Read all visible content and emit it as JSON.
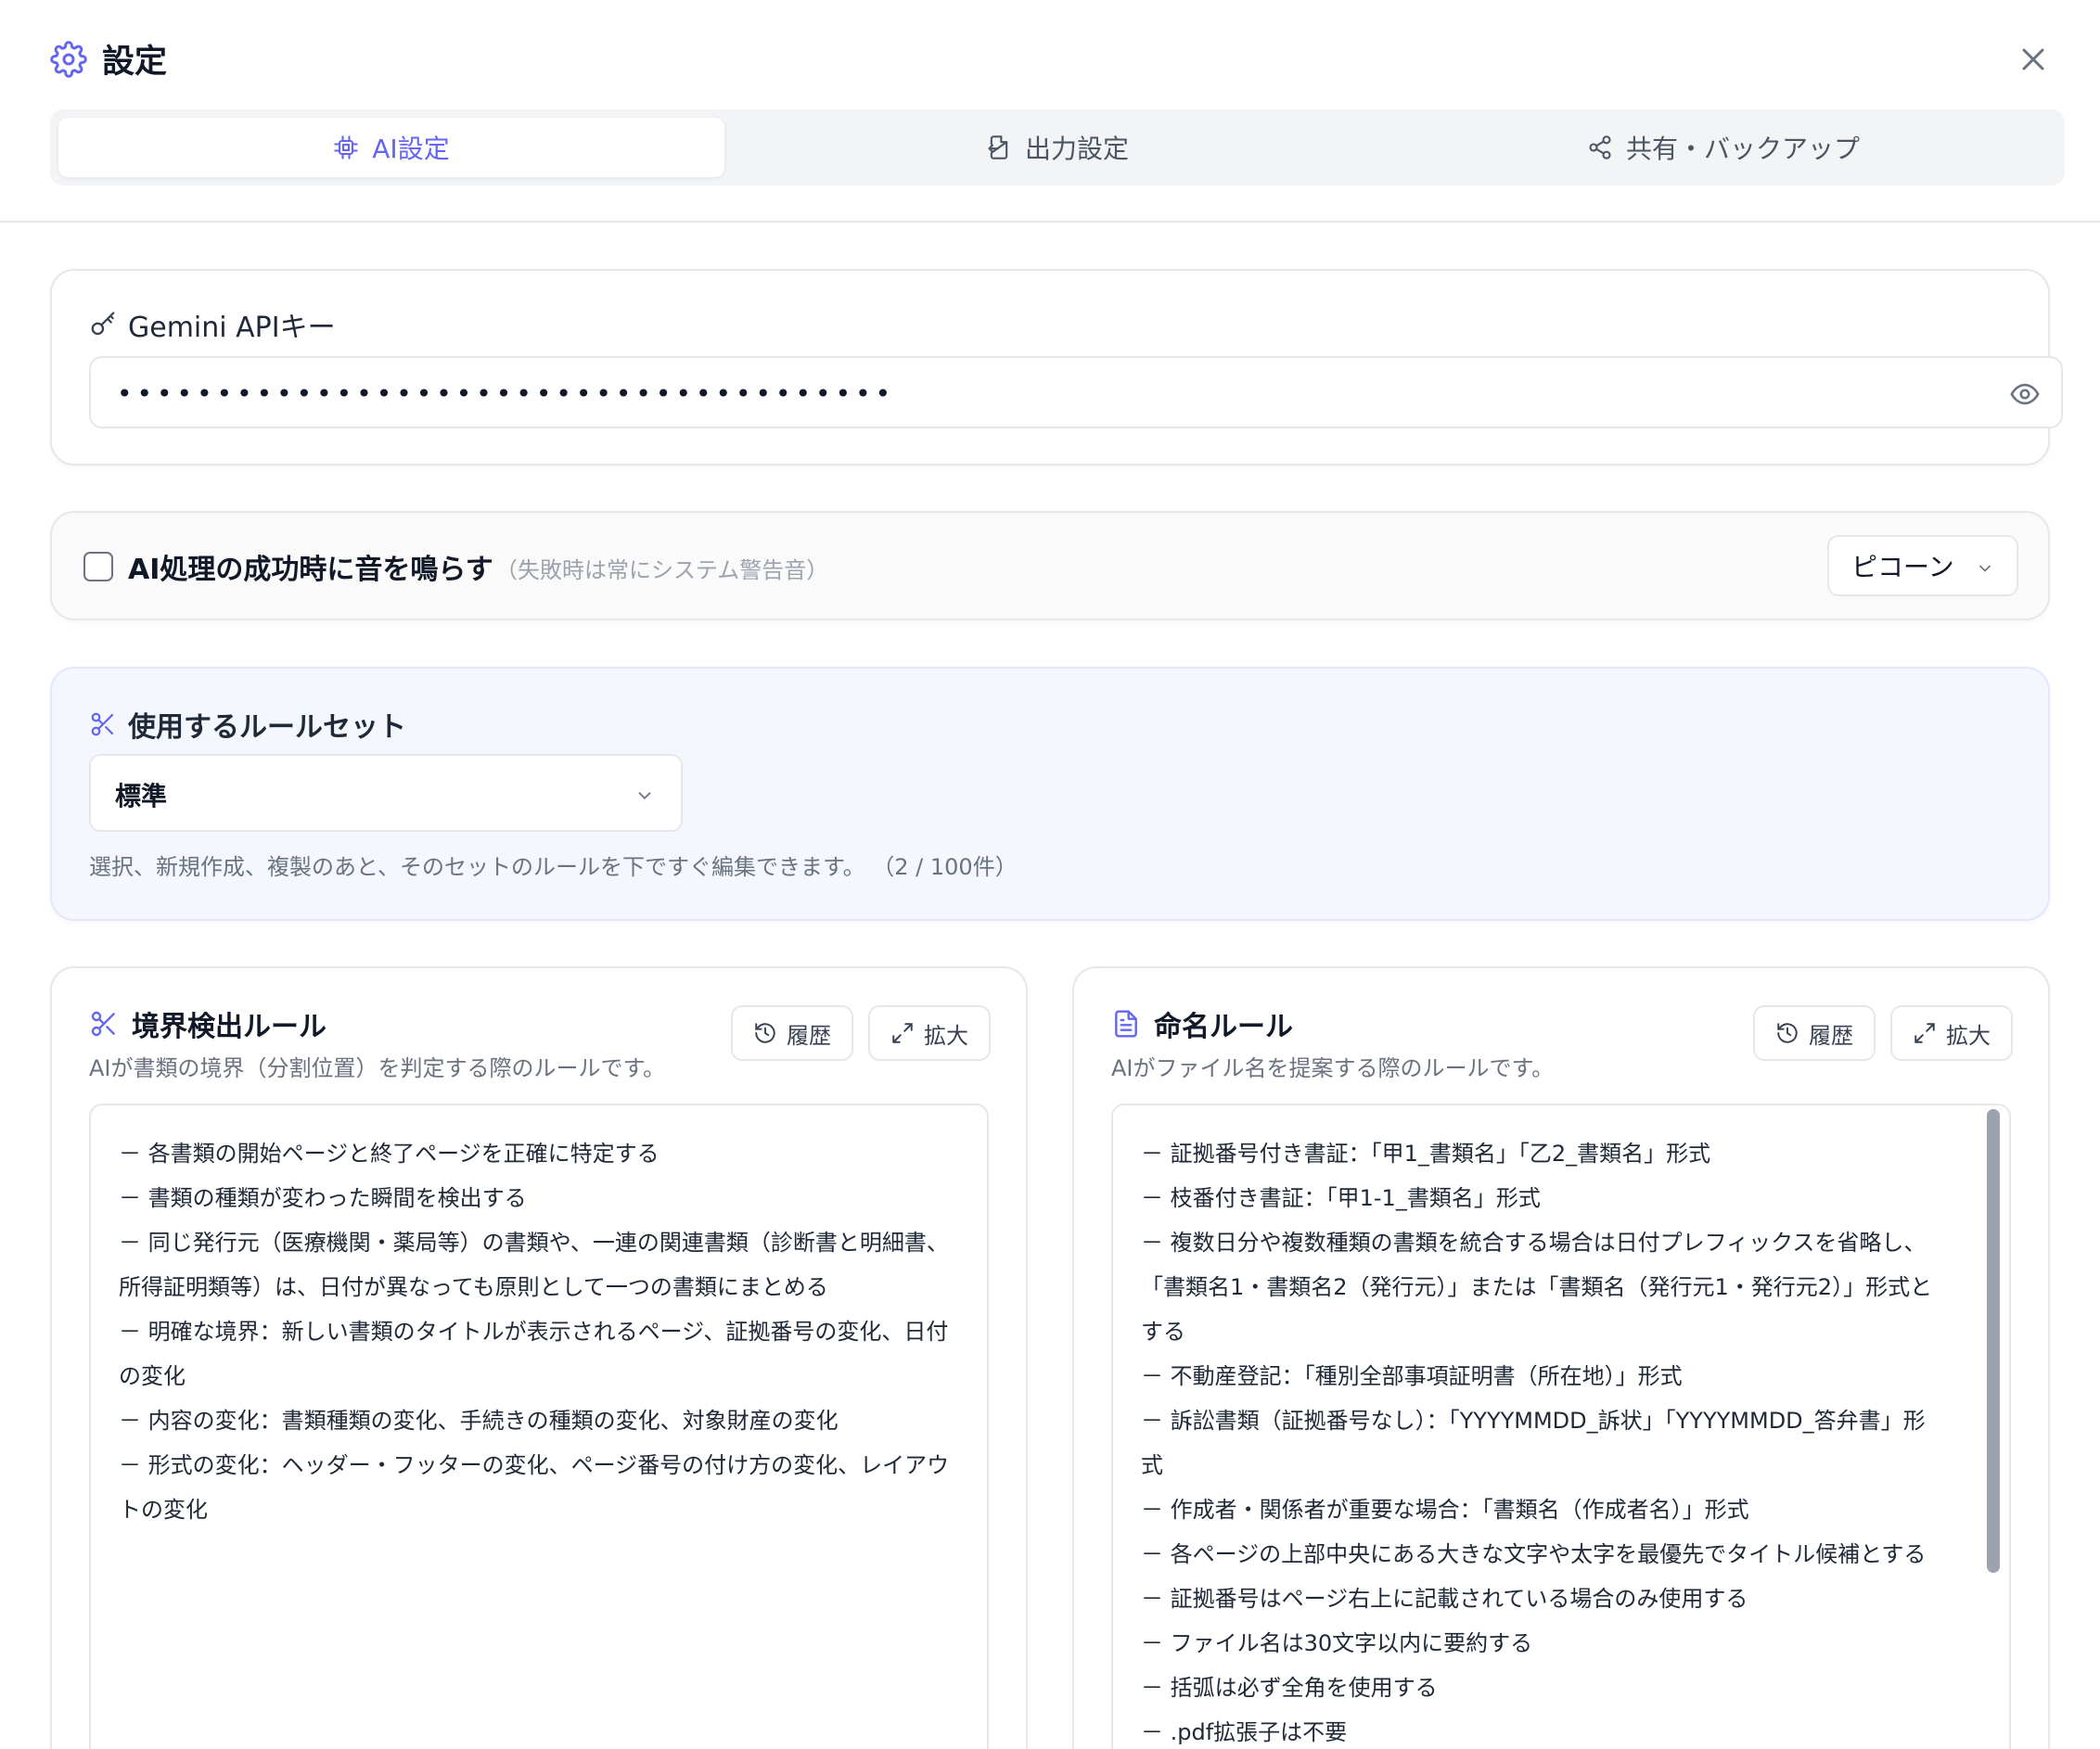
{
  "header": {
    "title": "設定",
    "close_label": "×"
  },
  "tabs": [
    {
      "label": "AI設定",
      "active": true,
      "icon": "chip-icon"
    },
    {
      "label": "出力設定",
      "active": false,
      "icon": "file-export-icon"
    },
    {
      "label": "共有・バックアップ",
      "active": false,
      "icon": "share-icon"
    }
  ],
  "api_key": {
    "label": "Gemini APIキー",
    "masked_value": "•••••••••••••••••••••••••••••••••••••••"
  },
  "sound": {
    "label": "AI処理の成功時に音を鳴らす",
    "note": "（失敗時は常にシステム警告音）",
    "checked": false,
    "selected_sound": "ピコーン"
  },
  "ruleset": {
    "label": "使用するルールセット",
    "selected": "標準",
    "help": "選択、新規作成、複製のあと、そのセットのルールを下ですぐ編集できます。 （2 / 100件）"
  },
  "boundary_rules": {
    "title": "境界検出ルール",
    "subtitle": "AIが書類の境界（分割位置）を判定する際のルールです。",
    "history_label": "履歴",
    "expand_label": "拡大",
    "lines": [
      "－ 各書類の開始ページと終了ページを正確に特定する",
      "－ 書類の種類が変わった瞬間を検出する",
      "－ 同じ発行元（医療機関・薬局等）の書類や、一連の関連書類（診断書と明細書、",
      "所得証明類等）は、日付が異なっても原則として一つの書類にまとめる",
      "－ 明確な境界：新しい書類のタイトルが表示されるページ、証拠番号の変化、日付",
      "の変化",
      "－ 内容の変化：書類種類の変化、手続きの種類の変化、対象財産の変化",
      "－ 形式の変化：ヘッダー・フッターの変化、ページ番号の付け方の変化、レイアウ",
      "トの変化"
    ]
  },
  "naming_rules": {
    "title": "命名ルール",
    "subtitle": "AIがファイル名を提案する際のルールです。",
    "history_label": "履歴",
    "expand_label": "拡大",
    "lines": [
      "－ 証拠番号付き書証：「甲1_書類名」「乙2_書類名」形式",
      "－ 枝番付き書証：「甲1-1_書類名」形式",
      "－ 複数日分や複数種類の書類を統合する場合は日付プレフィックスを省略し、",
      "「書類名1・書類名2（発行元）」または「書類名（発行元1・発行元2）」形式と",
      "する",
      "－ 不動産登記：「種別全部事項証明書（所在地）」形式",
      "－ 訴訟書類（証拠番号なし）：「YYYYMMDD_訴状」「YYYYMMDD_答弁書」形",
      "式",
      "－ 作成者・関係者が重要な場合：「書類名（作成者名）」形式",
      "－ 各ページの上部中央にある大きな文字や太字を最優先でタイトル候補とする",
      "－ 証拠番号はページ右上に記載されている場合のみ使用する",
      "－ ファイル名は30文字以内に要約する",
      "－ 括弧は必ず全角を使用する",
      "－ .pdf拡張子は不要"
    ]
  },
  "colors": {
    "accent": "#6366f1",
    "text": "#1f2937",
    "muted": "#6b7280",
    "border": "#e5e7eb"
  }
}
